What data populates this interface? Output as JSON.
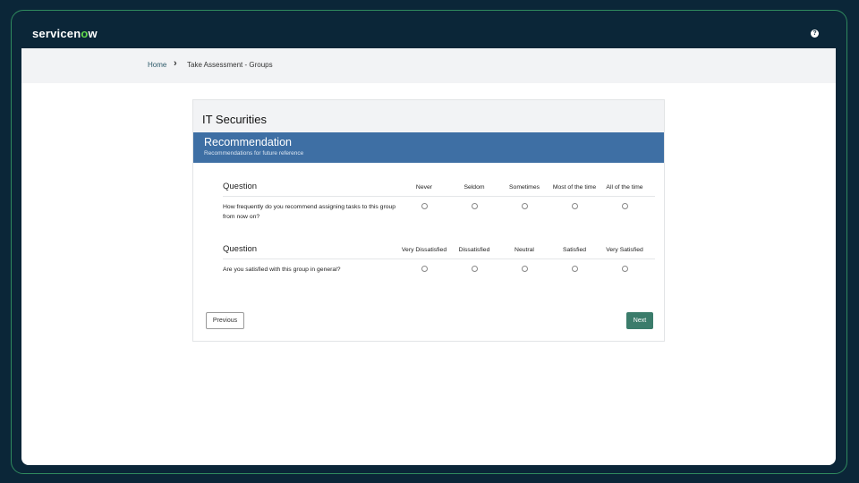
{
  "app": {
    "logo": "servicenow",
    "help_icon": "help-icon"
  },
  "breadcrumb": {
    "home": "Home",
    "separator": ">",
    "current": "Take Assessment - Groups"
  },
  "card": {
    "title": "IT Securities",
    "section": {
      "title": "Recommendation",
      "subtitle": "Recommendations for future reference"
    }
  },
  "questions": [
    {
      "header": "Question",
      "options": [
        "Never",
        "Seldom",
        "Sometimes",
        "Most of the time",
        "All of the time"
      ],
      "text": "How frequently do you recommend assigning tasks to this group from now on?",
      "selected": null
    },
    {
      "header": "Question",
      "options": [
        "Very Dissatisfied",
        "Dissatisfied",
        "Neutral",
        "Satisfied",
        "Very Satisfied"
      ],
      "text": "Are you satisfied with this group in general?",
      "selected": null
    }
  ],
  "buttons": {
    "previous": "Previous",
    "next": "Next"
  },
  "colors": {
    "section_header": "#3e6fa4",
    "next_button": "#3b7c6b",
    "topbar": "#0b2638"
  }
}
